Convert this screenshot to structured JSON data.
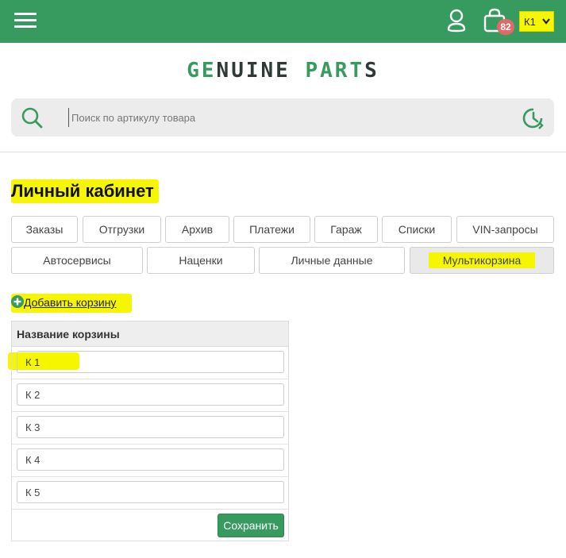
{
  "header": {
    "cart_count": "82",
    "cart_selected": "К1"
  },
  "logo": {
    "part1_green": "GE",
    "part1_dark": "NUINE",
    "part2_green": "PARTS",
    "part2_dark": "S"
  },
  "search": {
    "placeholder": "Поиск по артикулу товара"
  },
  "page_title": "Личный кабинет",
  "tabs_row1": [
    "Заказы",
    "Отгрузки",
    "Архив",
    "Платежи",
    "Гараж",
    "Списки",
    "VIN-запросы"
  ],
  "tabs_row2": [
    "Автосервисы",
    "Наценки",
    "Личные данные",
    "Мультикорзина"
  ],
  "add_basket_label": "Добавить корзину",
  "table": {
    "header": "Название корзины",
    "rows": [
      "К 1",
      "К 2",
      "К 3",
      "К 4",
      "К 5"
    ],
    "save_label": "Сохранить"
  },
  "colors": {
    "brand_green": "#379a5f",
    "highlight": "#f6f600",
    "badge": "#e06a6a"
  }
}
